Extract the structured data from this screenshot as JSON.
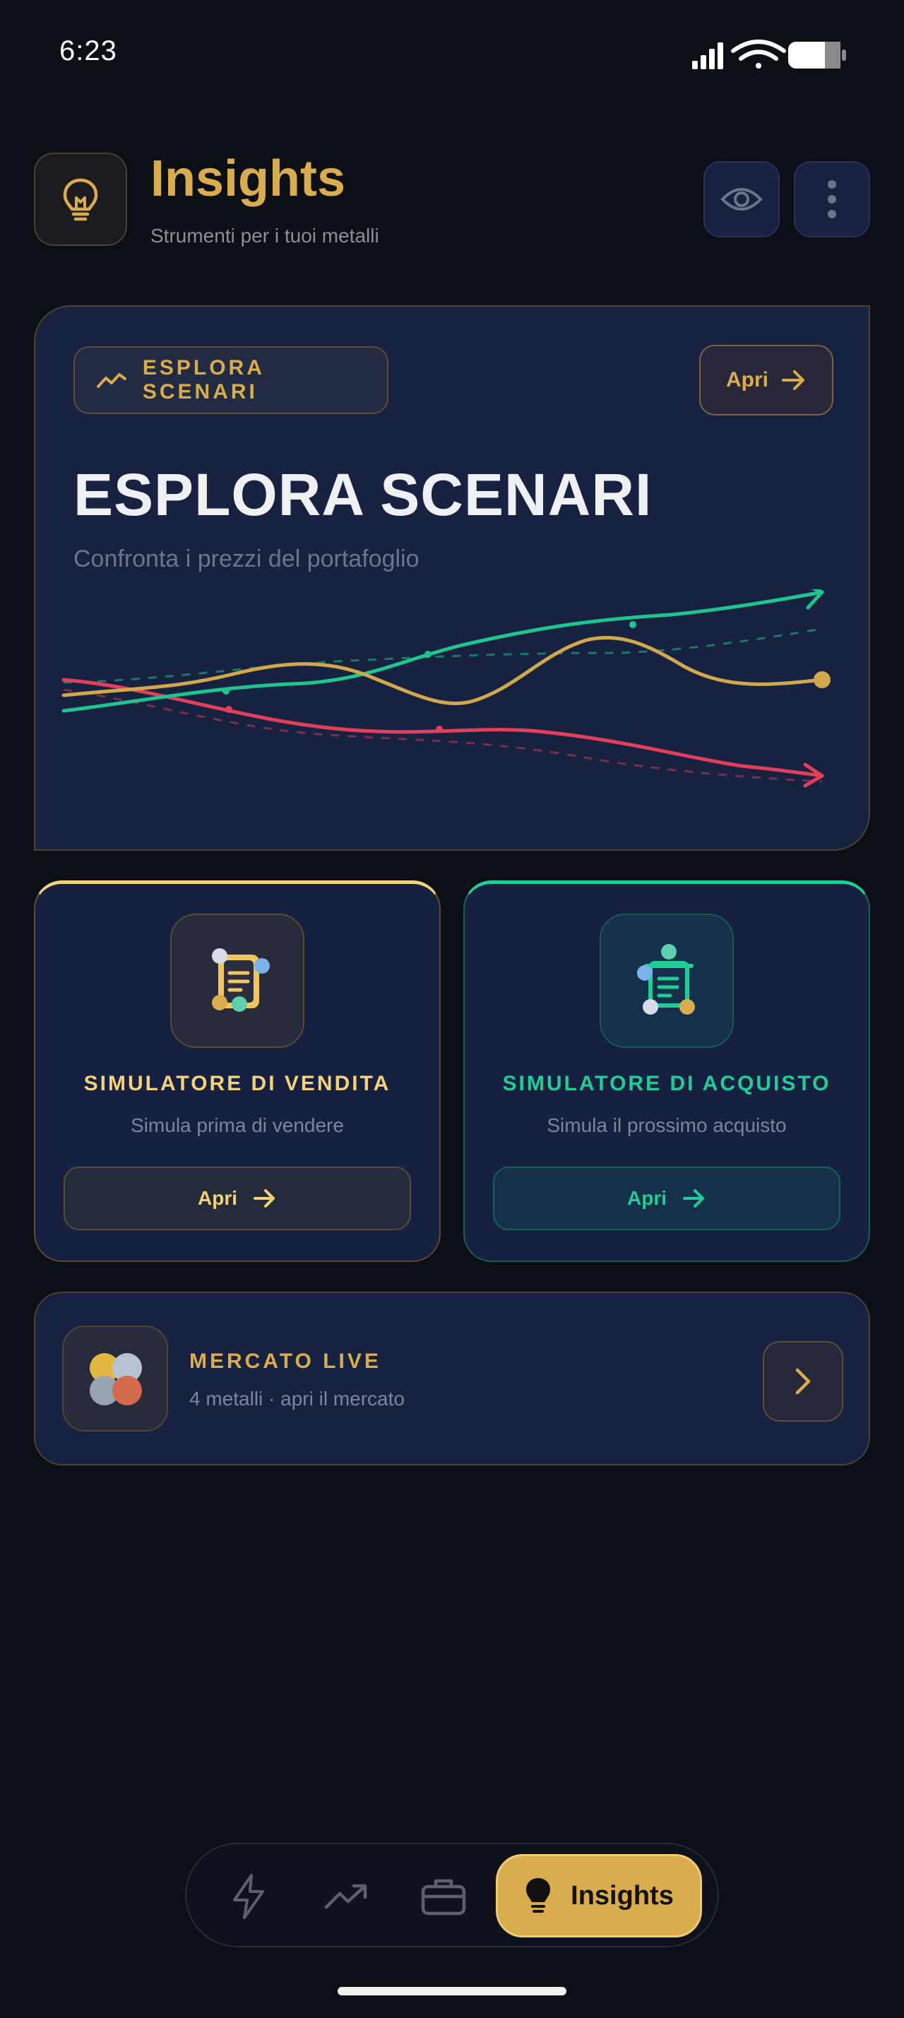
{
  "status_bar": {
    "time": "6:23",
    "icons": [
      "signal-icon",
      "wifi-icon",
      "battery-icon"
    ]
  },
  "header": {
    "icon": "lightbulb-icon",
    "title": "Insights",
    "subtitle": "Strumenti per i tuoi metalli",
    "actions": [
      "eye-icon",
      "more-vertical-icon"
    ]
  },
  "hero": {
    "chip_icon": "trend-line-icon",
    "chip_label": "ESPLORA SCENARI",
    "open_label": "Apri",
    "title": "ESPLORA SCENARI",
    "subtitle": "Confronta i prezzi del portafoglio",
    "chart_colors": {
      "up": "#1fc590",
      "gold": "#d2a84c",
      "down": "#e2405a"
    }
  },
  "simulators": [
    {
      "icon": "document-sell-icon",
      "title": "SIMULATORE DI VENDITA",
      "description": "Simula prima di vendere",
      "button_label": "Apri",
      "accent": "#f3d27a"
    },
    {
      "icon": "document-buy-icon",
      "title": "SIMULATORE DI ACQUISTO",
      "description": "Simula il prossimo acquisto",
      "button_label": "Apri",
      "accent": "#1fce95"
    }
  ],
  "market": {
    "icon": "metals-coins-icon",
    "title": "MERCATO LIVE",
    "subtitle": "4 metalli · apri il mercato"
  },
  "bottom_nav": {
    "items": [
      "lightning-icon",
      "trending-up-icon",
      "briefcase-icon"
    ],
    "active_icon": "lightbulb-icon",
    "active_label": "Insights"
  },
  "colors": {
    "background": "#0d0f17",
    "card": "#172241",
    "gold": "#d9ad4e",
    "green": "#1fce95"
  }
}
